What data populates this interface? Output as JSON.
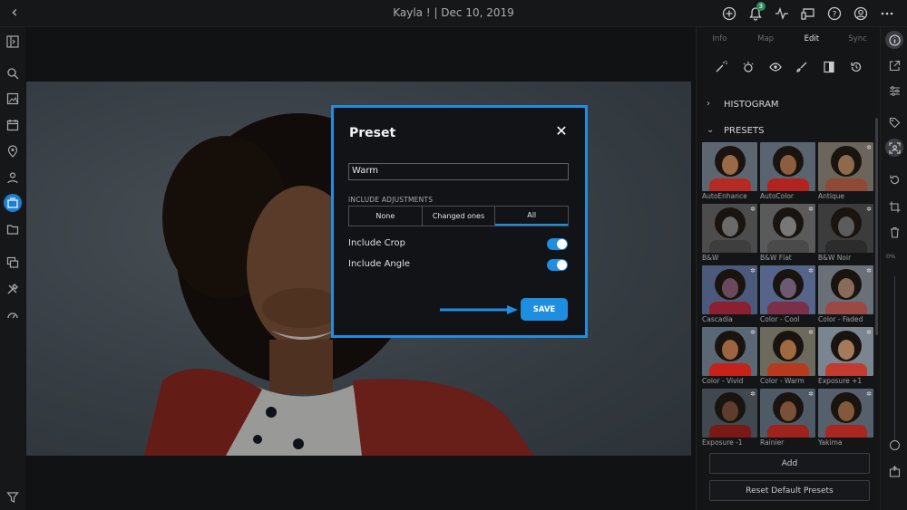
{
  "header": {
    "title": "Kayla ! | Dec 10, 2019",
    "notification_count": "3"
  },
  "modal": {
    "title": "Preset",
    "name_value": "Warm",
    "include_adjustments_label": "INCLUDE ADJUSTMENTS",
    "segments": [
      "None",
      "Changed ones",
      "All"
    ],
    "selected_segment": "All",
    "include_crop_label": "Include Crop",
    "include_crop_on": true,
    "include_angle_label": "Include Angle",
    "include_angle_on": true,
    "save_label": "SAVE"
  },
  "right_panel": {
    "tabs": [
      "Info",
      "Map",
      "Edit",
      "Sync"
    ],
    "selected_tab": "Edit",
    "histogram_label": "HISTOGRAM",
    "presets_label": "PRESETS",
    "presets": [
      {
        "name": "AutoEnhance"
      },
      {
        "name": "AutoColor"
      },
      {
        "name": "Antique"
      },
      {
        "name": "B&W"
      },
      {
        "name": "B&W Flat"
      },
      {
        "name": "B&W Noir"
      },
      {
        "name": "Cascadia"
      },
      {
        "name": "Color - Cool"
      },
      {
        "name": "Color - Faded"
      },
      {
        "name": "Color - Vivid"
      },
      {
        "name": "Color - Warm"
      },
      {
        "name": "Exposure +1"
      },
      {
        "name": "Exposure -1"
      },
      {
        "name": "Rainier"
      },
      {
        "name": "Yakima"
      }
    ],
    "add_label": "Add",
    "reset_label": "Reset Default Presets"
  },
  "right_toolbar": {
    "percent": "0%"
  },
  "colors": {
    "accent": "#1f8ee0",
    "background": "#111214"
  }
}
